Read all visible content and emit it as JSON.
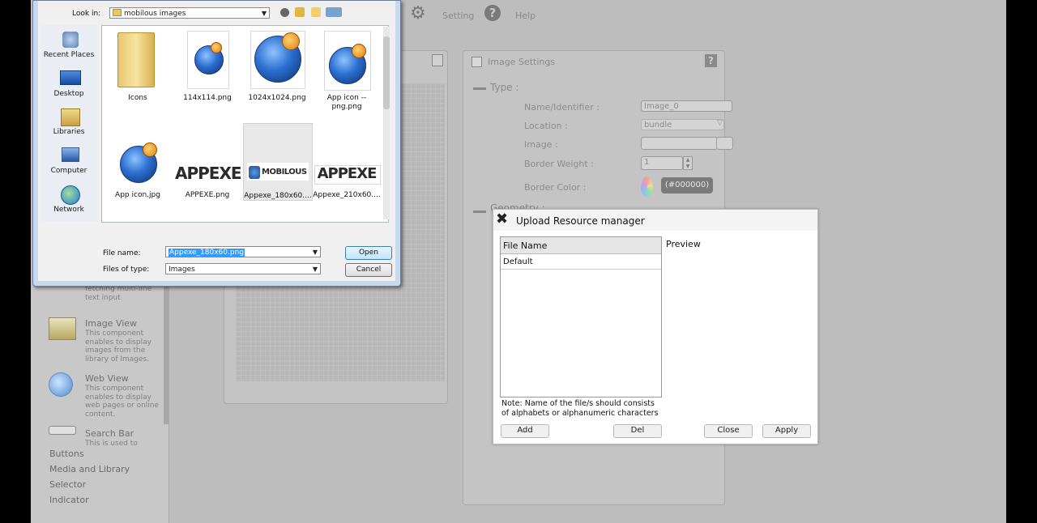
{
  "toolbar": {
    "setting_label": "Setting",
    "help_label": "Help"
  },
  "components": [
    {
      "title": "",
      "desc_line": "fetching multi-line text input"
    },
    {
      "title": "Image View",
      "desc": "This component enables to display images from the library of Images."
    },
    {
      "title": "Web View",
      "desc": "This component enables to display web pages or online content."
    },
    {
      "title": "Search Bar",
      "desc": "This is used to"
    }
  ],
  "categories": [
    "Buttons",
    "Media and Library",
    "Selector",
    "Indicator"
  ],
  "settings": {
    "title": "Image Settings",
    "help": "?",
    "section_type": "Type :",
    "section_geometry": "Geometry :",
    "name_label": "Name/Identifier :",
    "name_value": "Image_0",
    "location_label": "Location :",
    "location_value": "bundle",
    "image_label": "Image :",
    "border_weight_label": "Border Weight :",
    "border_weight_value": "1",
    "border_color_label": "Border Color :",
    "border_color_value": "(#000000)"
  },
  "upload": {
    "title": "Upload Resource manager",
    "column_header": "File Name",
    "rows": [
      "Default"
    ],
    "preview_label": "Preview",
    "note": "Note: Name of the file/s should consists of alphabets or alphanumeric characters",
    "add": "Add",
    "del": "Del",
    "close": "Close",
    "apply": "Apply"
  },
  "dialog": {
    "look_in_label": "Look in:",
    "look_in_value": "mobilous images",
    "places": [
      "Recent Places",
      "Desktop",
      "Libraries",
      "Computer",
      "Network"
    ],
    "files": [
      {
        "name": "Icons",
        "kind": "folder"
      },
      {
        "name": "114x114.png",
        "kind": "globe"
      },
      {
        "name": "1024x1024.png",
        "kind": "globe"
      },
      {
        "name": "App icon -- png.png",
        "kind": "globe"
      },
      {
        "name": "App icon.jpg",
        "kind": "globe"
      },
      {
        "name": "APPEXE.png",
        "kind": "appexe"
      },
      {
        "name": "Appexe_180x60....",
        "kind": "mobilous"
      },
      {
        "name": "Appexe_210x60....",
        "kind": "appexe"
      }
    ],
    "appexe_logo": "APPEXE",
    "mobilous_logo": "MOBILOUS",
    "file_name_label": "File name:",
    "file_name_value": "Appexe_180x60.png",
    "files_of_type_label": "Files of type:",
    "files_of_type_value": "Images",
    "open": "Open",
    "cancel": "Cancel"
  },
  "colors": {
    "accent": "#3399ff",
    "selection": "#3399ff",
    "dialog_frame": "#c9d9ec"
  }
}
